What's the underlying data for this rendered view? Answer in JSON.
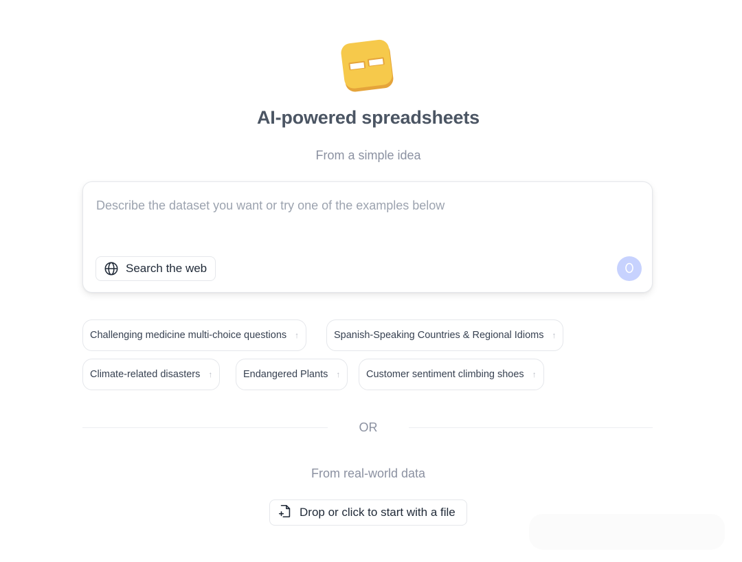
{
  "header": {
    "logo_icon": "table-logo-icon",
    "title": "AI-powered spreadsheets",
    "subtitle": "From a simple idea"
  },
  "prompt": {
    "placeholder": "Describe the dataset you want or try one of the examples below",
    "value": "",
    "web_search_label": "Search the web",
    "web_search_icon": "globe-icon",
    "send_icon": "send-icon"
  },
  "examples": [
    {
      "label": "Challenging medicine multi-choice questions",
      "icon": "arrow-up-icon"
    },
    {
      "label": "Spanish-Speaking Countries & Regional Idioms",
      "icon": "arrow-up-icon"
    },
    {
      "label": "Climate-related disasters",
      "icon": "arrow-up-icon"
    },
    {
      "label": "Endangered Plants",
      "icon": "arrow-up-icon"
    },
    {
      "label": "Customer sentiment climbing shoes",
      "icon": "arrow-up-icon"
    }
  ],
  "separator": {
    "label": "OR"
  },
  "file_section": {
    "subtitle": "From real-world data",
    "button_label": "Drop or click to start with a file",
    "icon": "file-add-icon"
  },
  "colors": {
    "logo_yellow": "#f6c94b",
    "logo_shadow": "#e5a43a",
    "send_button": "#c7d2fe",
    "border": "#e5e7eb"
  }
}
